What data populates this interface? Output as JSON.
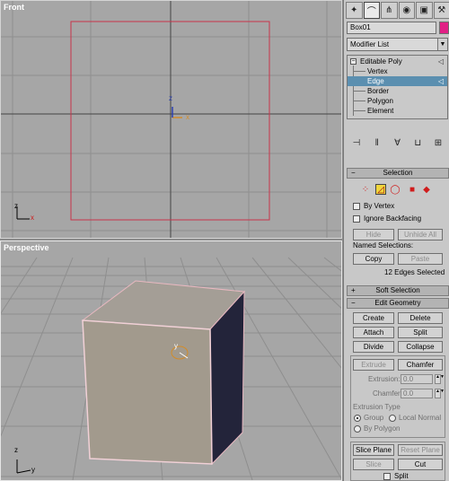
{
  "viewports": {
    "front_label": "Front",
    "persp_label": "Perspective",
    "axis_x": "x",
    "axis_y": "y",
    "axis_z": "z"
  },
  "command_panel": {
    "tabs": [
      "create-icon",
      "modify-icon",
      "hierarchy-icon",
      "motion-icon",
      "display-icon",
      "utilities-icon"
    ],
    "object_name": "Box01",
    "object_color": "#e11f85",
    "modifier_list": "Modifier List",
    "stack": {
      "root": "Editable Poly",
      "levels": [
        "Vertex",
        "Edge",
        "Border",
        "Polygon",
        "Element"
      ],
      "selected": "Edge"
    },
    "selection": {
      "title": "Selection",
      "by_vertex": "By Vertex",
      "ignore_backfacing": "Ignore Backfacing",
      "hide": "Hide",
      "unhide_all": "Unhide All",
      "named_selections": "Named Selections:",
      "copy": "Copy",
      "paste": "Paste",
      "status": "12 Edges Selected"
    },
    "soft_selection": {
      "title": "Soft Selection"
    },
    "edit_geometry": {
      "title": "Edit Geometry",
      "create": "Create",
      "delete": "Delete",
      "attach": "Attach",
      "split": "Split",
      "divide": "Divide",
      "collapse": "Collapse",
      "extrude": "Extrude",
      "chamfer": "Chamfer",
      "extrusion_label": "Extrusion:",
      "extrusion_value": "0.0",
      "chamfer_label": "Chamfer:",
      "chamfer_value": "0.0",
      "extrusion_type": "Extrusion Type",
      "group": "Group",
      "local_normal": "Local Normal",
      "by_polygon": "By Polygon",
      "slice_plane": "Slice Plane",
      "reset_plane": "Reset Plane",
      "slice": "Slice",
      "cut": "Cut",
      "split_chk": "Split"
    }
  }
}
